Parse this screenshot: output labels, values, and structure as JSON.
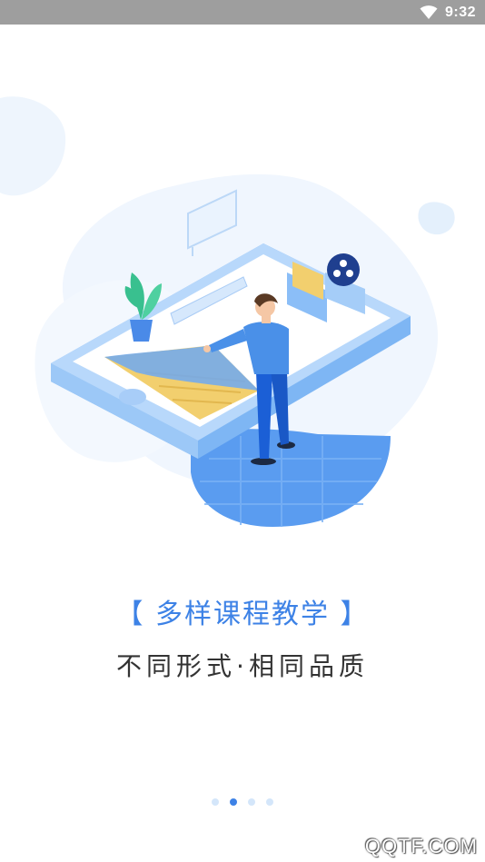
{
  "status_bar": {
    "time": "9:32",
    "icons": [
      "wifi-icon"
    ],
    "background": "#9e9e9e"
  },
  "slide": {
    "title": "【 多样课程教学 】",
    "subtitle": "不同形式·相同品质"
  },
  "pager": {
    "total": 4,
    "active_index": 1
  },
  "watermark": "QQTF.COM",
  "colors": {
    "accent": "#3d82e6",
    "dot_inactive": "#d4e6fa",
    "text_dark": "#333333"
  }
}
